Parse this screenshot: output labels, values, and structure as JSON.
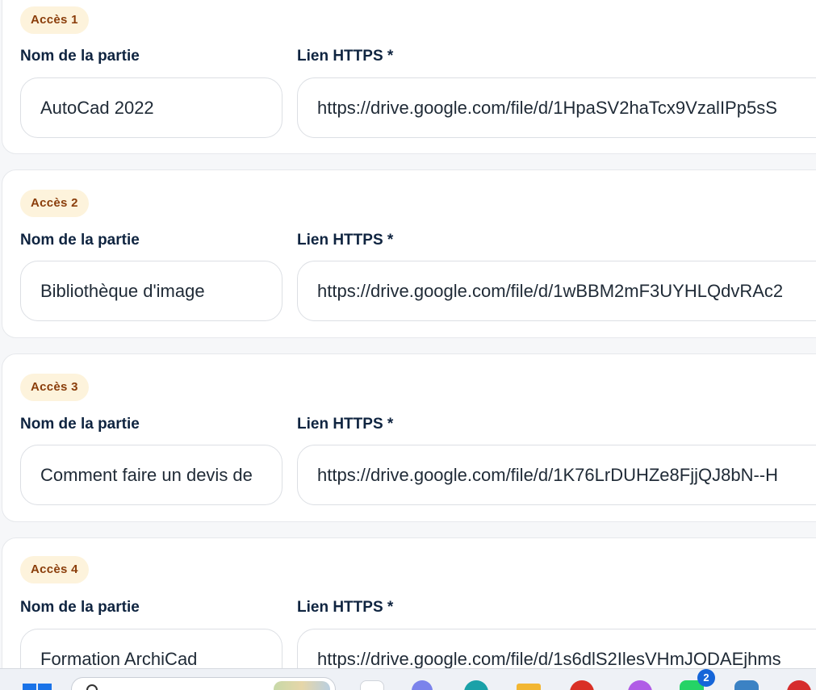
{
  "entries": [
    {
      "badge": "Accès 1",
      "name_label": "Nom de la partie",
      "url_label": "Lien HTTPS *",
      "name_value": "AutoCad 2022",
      "url_value": "https://drive.google.com/file/d/1HpaSV2haTcx9VzalIPp5sS"
    },
    {
      "badge": "Accès 2",
      "name_label": "Nom de la partie",
      "url_label": "Lien HTTPS *",
      "name_value": "Bibliothèque d'image",
      "url_value": "https://drive.google.com/file/d/1wBBM2mF3UYHLQdvRAc2"
    },
    {
      "badge": "Accès 3",
      "name_label": "Nom de la partie",
      "url_label": "Lien HTTPS *",
      "name_value": "Comment faire un devis de",
      "url_value": "https://drive.google.com/file/d/1K76LrDUHZe8FjjQJ8bN--H"
    },
    {
      "badge": "Accès 4",
      "name_label": "Nom de la partie",
      "url_label": "Lien HTTPS *",
      "name_value": "Formation ArchiCad",
      "url_value": "https://drive.google.com/file/d/1s6dlS2IlesVHmJODAEjhms"
    }
  ],
  "taskbar": {
    "notification_count": "2",
    "icons": [
      "windows-start-icon",
      "search-icon",
      "task-view-icon",
      "teams-icon",
      "edge-icon",
      "file-explorer-icon",
      "chrome-icon",
      "copilot-icon",
      "whatsapp-icon",
      "notepad-icon",
      "app-icon"
    ]
  }
}
